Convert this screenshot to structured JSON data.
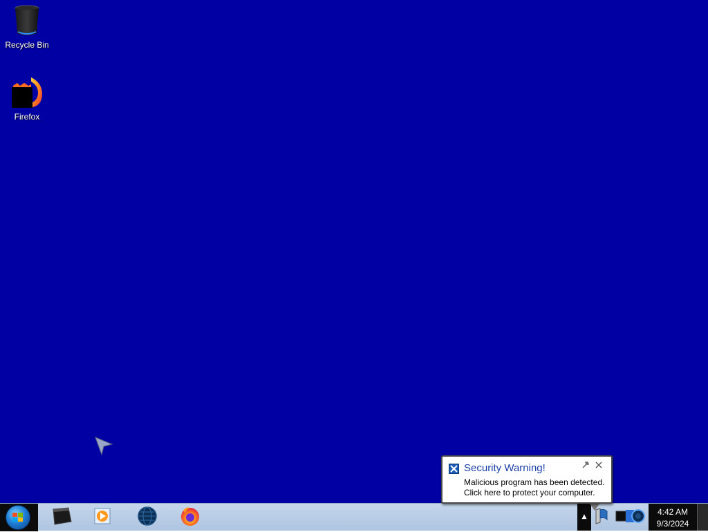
{
  "desktop": {
    "background_color": "#0000a3",
    "icons": [
      {
        "label": "Recycle Bin",
        "icon": "recycle-bin-icon"
      },
      {
        "label": "Firefox",
        "icon": "firefox-icon"
      }
    ]
  },
  "notification": {
    "title": "Security Warning!",
    "message_line1": "Malicious program has been detected.",
    "message_line2": "Click here to protect your computer.",
    "icon": "shield-x-icon",
    "options_icon": "wrench-icon",
    "close_icon": "close-icon",
    "title_color": "#1a3ea8"
  },
  "taskbar": {
    "start_icon": "windows-start-orb-icon",
    "pinned": [
      {
        "name": "terminal",
        "icon": "terminal-icon"
      },
      {
        "name": "media-player",
        "icon": "media-player-icon"
      },
      {
        "name": "browser-globe",
        "icon": "globe-icon"
      },
      {
        "name": "firefox",
        "icon": "firefox-icon"
      }
    ],
    "tray": {
      "show_hidden_icon": "chevron-up-icon",
      "icons": [
        "action-center-flag-icon",
        "network-icon"
      ]
    },
    "clock": {
      "time": "4:42 AM",
      "date": "9/3/2024"
    }
  }
}
